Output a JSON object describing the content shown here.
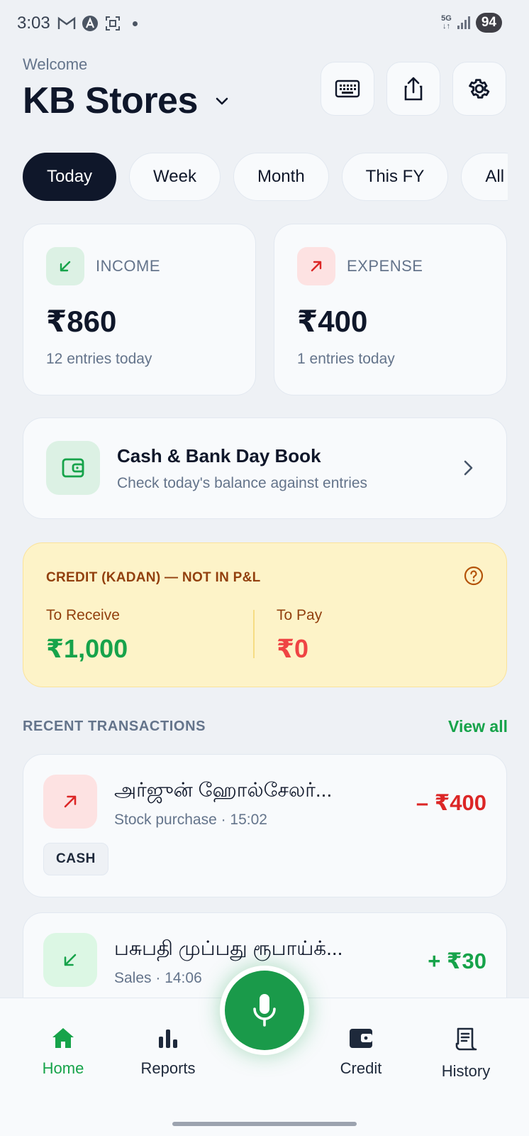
{
  "status_bar": {
    "time": "3:03",
    "network": "5G",
    "battery": "94"
  },
  "header": {
    "welcome": "Welcome",
    "store_name": "KB Stores"
  },
  "filters": [
    {
      "label": "Today",
      "active": true
    },
    {
      "label": "Week",
      "active": false
    },
    {
      "label": "Month",
      "active": false
    },
    {
      "label": "This FY",
      "active": false
    },
    {
      "label": "All",
      "active": false
    }
  ],
  "income": {
    "label": "INCOME",
    "amount": "₹860",
    "sub": "12 entries today"
  },
  "expense": {
    "label": "EXPENSE",
    "amount": "₹400",
    "sub": "1 entries today"
  },
  "day_book": {
    "title": "Cash & Bank Day Book",
    "sub": "Check today's balance against entries"
  },
  "credit": {
    "title": "CREDIT (KADAN) — NOT IN P&L",
    "receive_label": "To Receive",
    "receive_value": "₹1,000",
    "pay_label": "To Pay",
    "pay_value": "₹0"
  },
  "recent": {
    "title": "RECENT TRANSACTIONS",
    "view_all": "View all",
    "items": [
      {
        "title": "அர்ஜுன் ஹோல்சேலர்...",
        "sub": "Stock purchase · 15:02",
        "amount": "– ₹400",
        "badge": "CASH",
        "type": "expense"
      },
      {
        "title": "பசுபதி முப்பது ரூபாய்க்...",
        "sub": "Sales · 14:06",
        "amount": "+ ₹30",
        "type": "income"
      }
    ]
  },
  "nav": {
    "home": "Home",
    "reports": "Reports",
    "credit": "Credit",
    "history": "History"
  },
  "colors": {
    "green": "#16a34a",
    "red": "#dc2626",
    "dark": "#0f172a",
    "credit_bg": "#fdf3c8"
  }
}
